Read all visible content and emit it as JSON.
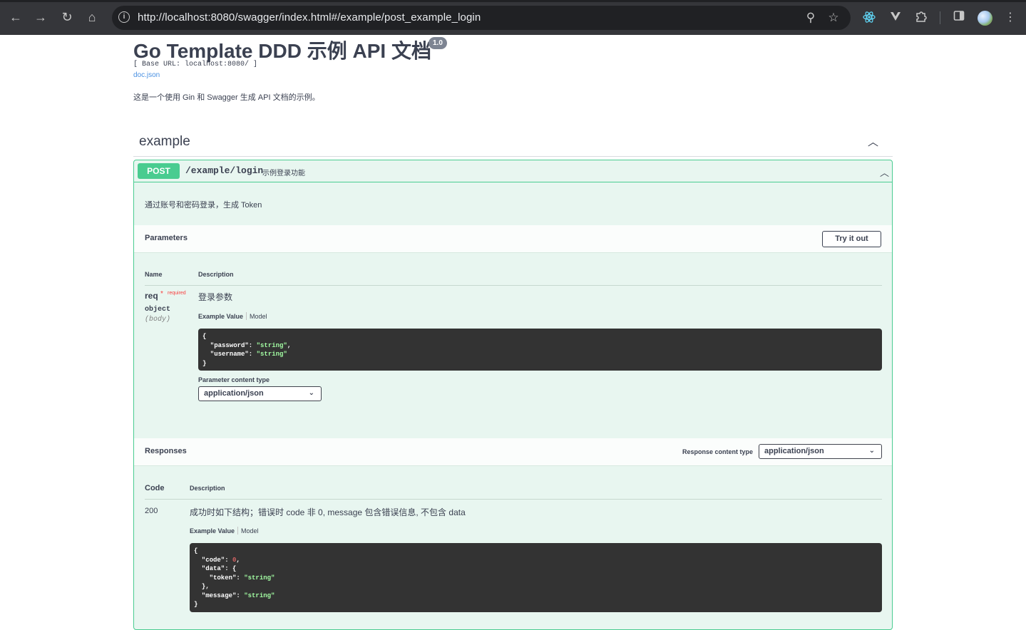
{
  "browser": {
    "url": "http://localhost:8080/swagger/index.html#/example/post_example_login",
    "back_icon": "←",
    "forward_icon": "→",
    "reload_icon": "↻",
    "home_icon": "⌂",
    "info_icon": "i",
    "search_icon": "⚲",
    "star_icon": "☆",
    "menu_icon": "⋮"
  },
  "info": {
    "title": "Go Template DDD 示例 API 文档",
    "version": "1.0",
    "base_url": "[ Base URL: localhost:8080/ ]",
    "doc_link": "doc.json",
    "description": "这是一个使用 Gin 和 Swagger 生成 API 文档的示例。"
  },
  "tag": {
    "name": "example",
    "chevron": "︿"
  },
  "operation": {
    "method": "POST",
    "path": "/example/login",
    "summary": "示例登录功能",
    "chevron": "︿",
    "description": "通过账号和密码登录，生成 Token"
  },
  "parameters": {
    "title": "Parameters",
    "try_button": "Try it out",
    "col_name": "Name",
    "col_description": "Description",
    "param": {
      "name": "req",
      "star": "*",
      "required": "required",
      "type": "object",
      "in": "(body)",
      "description": "登录参数"
    },
    "tab_example": "Example Value",
    "tab_model": "Model",
    "content_type_label": "Parameter content type",
    "content_type": "application/json",
    "example_lines": [
      {
        "t": "{"
      },
      {
        "k": "  \"password\": ",
        "s": "\"string\"",
        "e": ","
      },
      {
        "k": "  \"username\": ",
        "s": "\"string\""
      },
      {
        "t": "}"
      }
    ]
  },
  "responses": {
    "title": "Responses",
    "content_type_label": "Response content type",
    "content_type": "application/json",
    "col_code": "Code",
    "col_description": "Description",
    "code": "200",
    "description": "成功时如下结构；错误时 code 非 0, message 包含错误信息, 不包含 data",
    "tab_example": "Example Value",
    "tab_model": "Model",
    "example_lines": [
      {
        "t": "{"
      },
      {
        "k": "  \"code\": ",
        "n": "0",
        "e": ","
      },
      {
        "k": "  \"data\": {"
      },
      {
        "k": "    \"token\": ",
        "s": "\"string\""
      },
      {
        "k": "  },"
      },
      {
        "k": "  \"message\": ",
        "s": "\"string\""
      },
      {
        "t": "}"
      }
    ]
  },
  "colors": {
    "post_green": "#49cc90",
    "post_bg": "#e8f6f0",
    "code_bg": "#333333",
    "required_red": "#f93e3e",
    "link_blue": "#4990e2"
  }
}
